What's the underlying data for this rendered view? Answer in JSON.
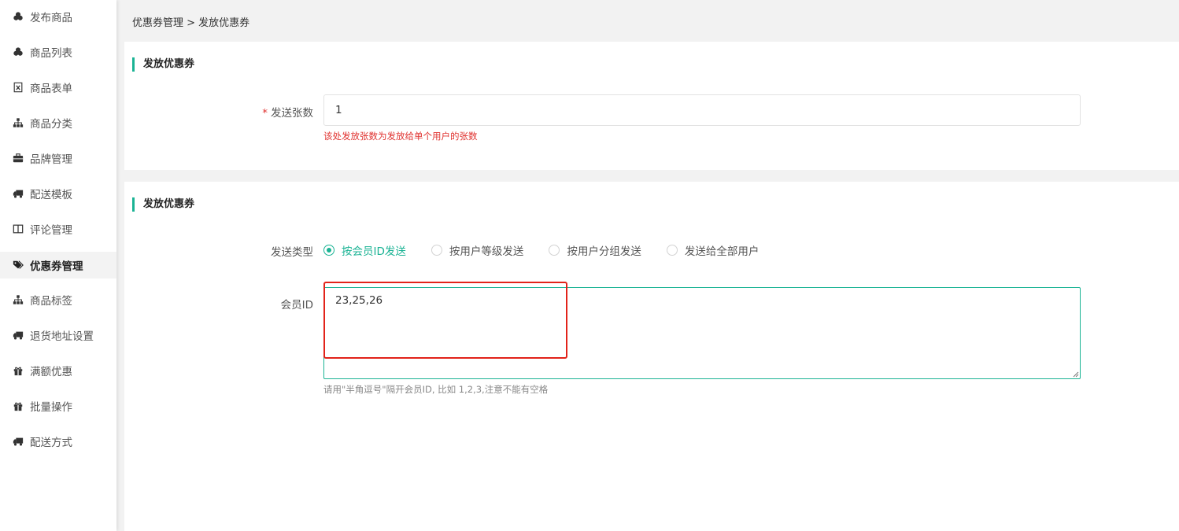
{
  "sidebar": {
    "items": [
      {
        "label": "发布商品",
        "icon": "cubes-icon",
        "active": false
      },
      {
        "label": "商品列表",
        "icon": "cubes-icon",
        "active": false
      },
      {
        "label": "商品表单",
        "icon": "excel-file-icon",
        "active": false
      },
      {
        "label": "商品分类",
        "icon": "sitemap-icon",
        "active": false
      },
      {
        "label": "品牌管理",
        "icon": "briefcase-icon",
        "active": false
      },
      {
        "label": "配送模板",
        "icon": "truck-icon",
        "active": false
      },
      {
        "label": "评论管理",
        "icon": "columns-icon",
        "active": false
      },
      {
        "label": "优惠券管理",
        "icon": "tags-icon",
        "active": true
      },
      {
        "label": "商品标签",
        "icon": "sitemap-icon",
        "active": false
      },
      {
        "label": "退货地址设置",
        "icon": "truck-icon",
        "active": false
      },
      {
        "label": "满额优惠",
        "icon": "gift-icon",
        "active": false
      },
      {
        "label": "批量操作",
        "icon": "gift-icon",
        "active": false
      },
      {
        "label": "配送方式",
        "icon": "truck-icon",
        "active": false
      }
    ]
  },
  "breadcrumb": "优惠券管理 > 发放优惠券",
  "section1": {
    "title": "发放优惠券",
    "required_mark": "*",
    "count_label": "发送张数",
    "count_value": "1",
    "count_hint": "该处发放张数为发放给单个用户的张数"
  },
  "section2": {
    "title": "发放优惠券",
    "type_label": "发送类型",
    "options": [
      {
        "label": "按会员ID发送",
        "checked": true
      },
      {
        "label": "按用户等级发送",
        "checked": false
      },
      {
        "label": "按用户分组发送",
        "checked": false
      },
      {
        "label": "发送给全部用户",
        "checked": false
      }
    ],
    "member_label": "会员ID",
    "member_value": "23,25,26",
    "member_hint": "请用\"半角逗号\"隔开会员ID, 比如 1,2,3,注意不能有空格"
  },
  "colors": {
    "accent": "#1ab394",
    "required": "#e0322f",
    "highlight": "#e2231a"
  }
}
